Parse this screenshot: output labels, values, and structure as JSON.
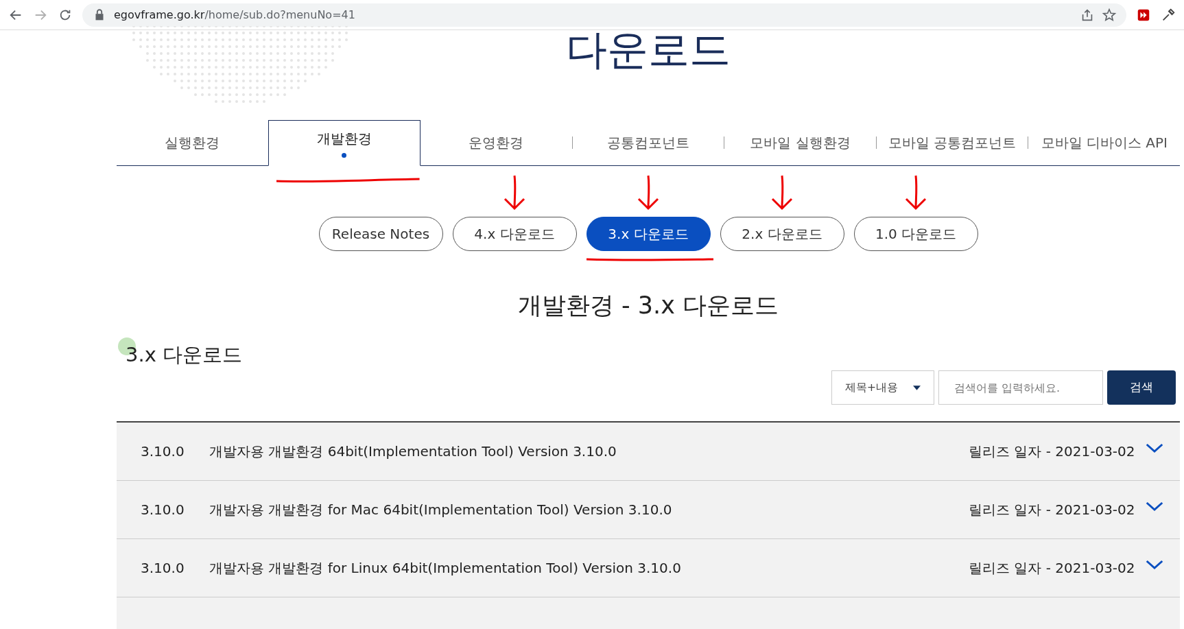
{
  "browser": {
    "url_host": "egovframe.go.kr",
    "url_path": "/home/sub.do?menuNo=41"
  },
  "page_title": "다운로드",
  "tabs": [
    {
      "label": "실행환경",
      "selected": false
    },
    {
      "label": "개발환경",
      "selected": true
    },
    {
      "label": "운영환경",
      "selected": false
    },
    {
      "label": "공통컴포넌트",
      "selected": false
    },
    {
      "label": "모바일 실행환경",
      "selected": false
    },
    {
      "label": "모바일 공통컴포넌트",
      "selected": false
    },
    {
      "label": "모바일 디바이스 API",
      "selected": false
    }
  ],
  "sub_tabs": [
    {
      "label": "Release Notes",
      "selected": false,
      "marked": false
    },
    {
      "label": "4.x 다운로드",
      "selected": false,
      "marked": true
    },
    {
      "label": "3.x 다운로드",
      "selected": true,
      "marked": true
    },
    {
      "label": "2.x 다운로드",
      "selected": false,
      "marked": true
    },
    {
      "label": "1.0 다운로드",
      "selected": false,
      "marked": true
    }
  ],
  "heading": "개발환경 - 3.x 다운로드",
  "section_title": "3.x 다운로드",
  "search": {
    "scope": "제목+내용",
    "placeholder": "검색어를 입력하세요.",
    "button": "검색"
  },
  "rows": [
    {
      "version": "3.10.0",
      "title": "개발자용 개발환경 64bit(Implementation Tool) Version 3.10.0",
      "date": "릴리즈 일자 - 2021-03-02"
    },
    {
      "version": "3.10.0",
      "title": "개발자용 개발환경 for Mac 64bit(Implementation Tool) Version 3.10.0",
      "date": "릴리즈 일자 - 2021-03-02"
    },
    {
      "version": "3.10.0",
      "title": "개발자용 개발환경 for Linux 64bit(Implementation Tool) Version 3.10.0",
      "date": "릴리즈 일자 - 2021-03-02"
    }
  ]
}
